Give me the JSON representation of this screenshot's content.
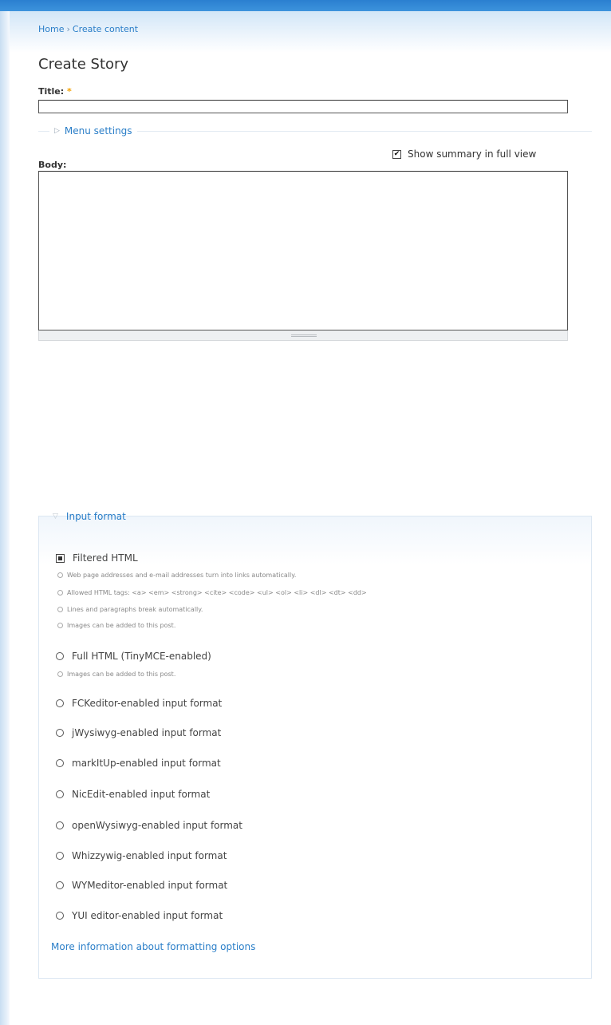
{
  "breadcrumb": {
    "home": "Home",
    "separator": "›",
    "current": "Create content"
  },
  "page": {
    "title": "Create Story"
  },
  "title_field": {
    "label": "Title:",
    "required_mark": "*",
    "value": ""
  },
  "menu_settings": {
    "legend": "Menu settings"
  },
  "summary_toggle": {
    "label": "Show summary in full view",
    "checked": true
  },
  "body_field": {
    "label": "Body:",
    "value": ""
  },
  "input_format": {
    "legend": "Input format",
    "options": [
      {
        "label": "Filtered HTML",
        "selected": true,
        "tips": [
          "Web page addresses and e-mail addresses turn into links automatically.",
          "Allowed HTML tags: <a> <em> <strong> <cite> <code> <ul> <ol> <li> <dl> <dt> <dd>",
          "Lines and paragraphs break automatically.",
          "Images can be added to this post."
        ]
      },
      {
        "label": "Full HTML (TinyMCE-enabled)",
        "selected": false,
        "tips": [
          "Images can be added to this post."
        ]
      },
      {
        "label": "FCKeditor-enabled input format",
        "selected": false,
        "tips": []
      },
      {
        "label": "jWysiwyg-enabled input format",
        "selected": false,
        "tips": []
      },
      {
        "label": "markItUp-enabled input format",
        "selected": false,
        "tips": []
      },
      {
        "label": "NicEdit-enabled input format",
        "selected": false,
        "tips": []
      },
      {
        "label": "openWysiwyg-enabled input format",
        "selected": false,
        "tips": []
      },
      {
        "label": "Whizzywig-enabled input format",
        "selected": false,
        "tips": []
      },
      {
        "label": "WYMeditor-enabled input format",
        "selected": false,
        "tips": []
      },
      {
        "label": "YUI editor-enabled input format",
        "selected": false,
        "tips": []
      }
    ],
    "more_link": "More information about formatting options"
  }
}
